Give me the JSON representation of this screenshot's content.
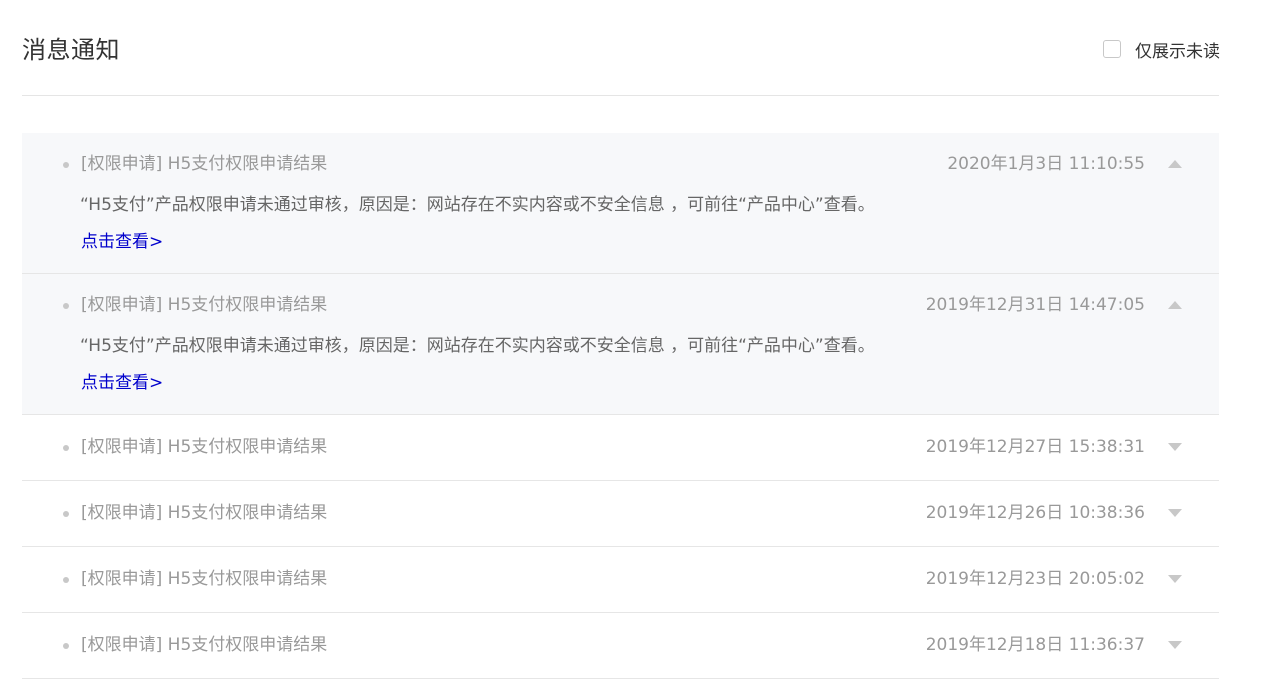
{
  "header": {
    "title": "消息通知",
    "unread_only_label": "仅展示未读",
    "unread_only_checked": false
  },
  "messages": [
    {
      "title": "[权限申请] H5支付权限申请结果",
      "time": "2020年1月3日 11:10:55",
      "expanded": true,
      "body": "“H5支付”产品权限申请未通过审核，原因是：网站存在不实内容或不安全信息 ，可前往“产品中心”查看。",
      "link_text": "点击查看>",
      "arrow_icon": "chevron-up-icon"
    },
    {
      "title": "[权限申请] H5支付权限申请结果",
      "time": "2019年12月31日 14:47:05",
      "expanded": true,
      "body": "“H5支付”产品权限申请未通过审核，原因是：网站存在不实内容或不安全信息 ，可前往“产品中心”查看。",
      "link_text": "点击查看>",
      "arrow_icon": "chevron-up-icon"
    },
    {
      "title": "[权限申请] H5支付权限申请结果",
      "time": "2019年12月27日 15:38:31",
      "expanded": false,
      "arrow_icon": "chevron-down-icon"
    },
    {
      "title": "[权限申请] H5支付权限申请结果",
      "time": "2019年12月26日 10:38:36",
      "expanded": false,
      "arrow_icon": "chevron-down-icon"
    },
    {
      "title": "[权限申请] H5支付权限申请结果",
      "time": "2019年12月23日 20:05:02",
      "expanded": false,
      "arrow_icon": "chevron-down-icon"
    },
    {
      "title": "[权限申请] H5支付权限申请结果",
      "time": "2019年12月18日 11:36:37",
      "expanded": false,
      "arrow_icon": "chevron-down-icon"
    }
  ],
  "colors": {
    "expanded_background": "#f7f8fa",
    "link": "#0000cc",
    "muted_text": "#999999",
    "divider": "#e6e6e6"
  }
}
